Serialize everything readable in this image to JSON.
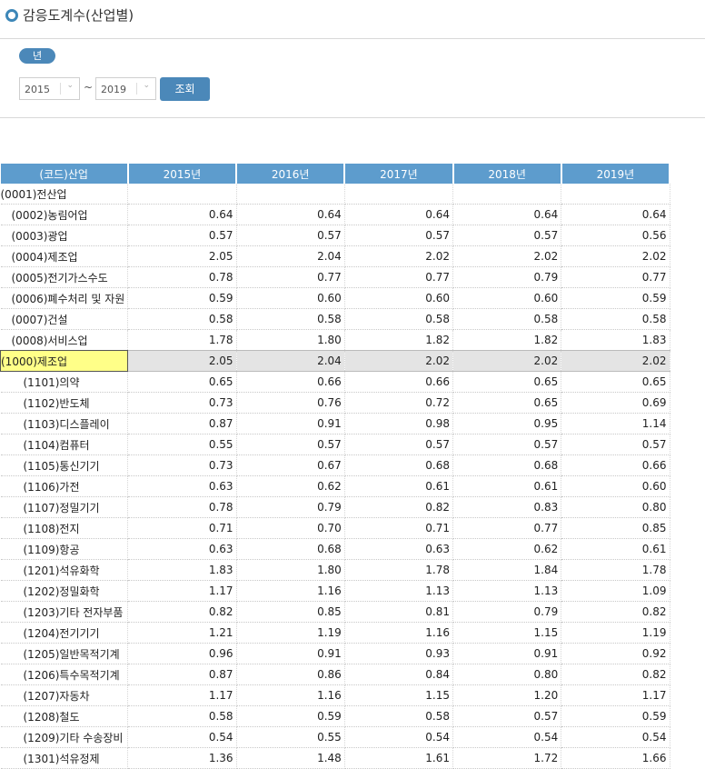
{
  "page": {
    "title": "감응도계수(산업별)"
  },
  "filter": {
    "year_label": "년",
    "from_year": "2015",
    "tilde": "~",
    "to_year": "2019",
    "search_label": "조회"
  },
  "grid": {
    "header_industry": "(코드)산업",
    "years": [
      "2015년",
      "2016년",
      "2017년",
      "2018년",
      "2019년"
    ],
    "rows": [
      {
        "label": "(0001)전산업",
        "level": 0,
        "values": [
          "",
          "",
          "",
          "",
          ""
        ]
      },
      {
        "label": "(0002)농림어업",
        "level": 1,
        "values": [
          "0.64",
          "0.64",
          "0.64",
          "0.64",
          "0.64"
        ]
      },
      {
        "label": "(0003)광업",
        "level": 1,
        "values": [
          "0.57",
          "0.57",
          "0.57",
          "0.57",
          "0.56"
        ]
      },
      {
        "label": "(0004)제조업",
        "level": 1,
        "values": [
          "2.05",
          "2.04",
          "2.02",
          "2.02",
          "2.02"
        ]
      },
      {
        "label": "(0005)전기가스수도",
        "level": 1,
        "values": [
          "0.78",
          "0.77",
          "0.77",
          "0.79",
          "0.77"
        ]
      },
      {
        "label": "(0006)폐수처리 및 자원",
        "level": 1,
        "values": [
          "0.59",
          "0.60",
          "0.60",
          "0.60",
          "0.59"
        ]
      },
      {
        "label": "(0007)건설",
        "level": 1,
        "values": [
          "0.58",
          "0.58",
          "0.58",
          "0.58",
          "0.58"
        ]
      },
      {
        "label": "(0008)서비스업",
        "level": 1,
        "values": [
          "1.78",
          "1.80",
          "1.82",
          "1.82",
          "1.83"
        ]
      },
      {
        "label": "(1000)제조업",
        "level": 0,
        "selected": true,
        "values": [
          "2.05",
          "2.04",
          "2.02",
          "2.02",
          "2.02"
        ]
      },
      {
        "label": "(1101)의약",
        "level": 2,
        "values": [
          "0.65",
          "0.66",
          "0.66",
          "0.65",
          "0.65"
        ]
      },
      {
        "label": "(1102)반도체",
        "level": 2,
        "values": [
          "0.73",
          "0.76",
          "0.72",
          "0.65",
          "0.69"
        ]
      },
      {
        "label": "(1103)디스플레이",
        "level": 2,
        "values": [
          "0.87",
          "0.91",
          "0.98",
          "0.95",
          "1.14"
        ]
      },
      {
        "label": "(1104)컴퓨터",
        "level": 2,
        "values": [
          "0.55",
          "0.57",
          "0.57",
          "0.57",
          "0.57"
        ]
      },
      {
        "label": "(1105)통신기기",
        "level": 2,
        "values": [
          "0.73",
          "0.67",
          "0.68",
          "0.68",
          "0.66"
        ]
      },
      {
        "label": "(1106)가전",
        "level": 2,
        "values": [
          "0.63",
          "0.62",
          "0.61",
          "0.61",
          "0.60"
        ]
      },
      {
        "label": "(1107)정밀기기",
        "level": 2,
        "values": [
          "0.78",
          "0.79",
          "0.82",
          "0.83",
          "0.80"
        ]
      },
      {
        "label": "(1108)전지",
        "level": 2,
        "values": [
          "0.71",
          "0.70",
          "0.71",
          "0.77",
          "0.85"
        ]
      },
      {
        "label": "(1109)항공",
        "level": 2,
        "values": [
          "0.63",
          "0.68",
          "0.63",
          "0.62",
          "0.61"
        ]
      },
      {
        "label": "(1201)석유화학",
        "level": 2,
        "values": [
          "1.83",
          "1.80",
          "1.78",
          "1.84",
          "1.78"
        ]
      },
      {
        "label": "(1202)정밀화학",
        "level": 2,
        "values": [
          "1.17",
          "1.16",
          "1.13",
          "1.13",
          "1.09"
        ]
      },
      {
        "label": "(1203)기타 전자부품",
        "level": 2,
        "values": [
          "0.82",
          "0.85",
          "0.81",
          "0.79",
          "0.82"
        ]
      },
      {
        "label": "(1204)전기기기",
        "level": 2,
        "values": [
          "1.21",
          "1.19",
          "1.16",
          "1.15",
          "1.19"
        ]
      },
      {
        "label": "(1205)일반목적기계",
        "level": 2,
        "values": [
          "0.96",
          "0.91",
          "0.93",
          "0.91",
          "0.92"
        ]
      },
      {
        "label": "(1206)특수목적기계",
        "level": 2,
        "values": [
          "0.87",
          "0.86",
          "0.84",
          "0.80",
          "0.82"
        ]
      },
      {
        "label": "(1207)자동차",
        "level": 2,
        "values": [
          "1.17",
          "1.16",
          "1.15",
          "1.20",
          "1.17"
        ]
      },
      {
        "label": "(1208)철도",
        "level": 2,
        "values": [
          "0.58",
          "0.59",
          "0.58",
          "0.57",
          "0.59"
        ]
      },
      {
        "label": "(1209)기타 수송장비",
        "level": 2,
        "values": [
          "0.54",
          "0.55",
          "0.54",
          "0.54",
          "0.54"
        ]
      },
      {
        "label": "(1301)석유정제",
        "level": 2,
        "values": [
          "1.36",
          "1.48",
          "1.61",
          "1.72",
          "1.66"
        ]
      }
    ]
  },
  "colors": {
    "accent": "#4b88b9",
    "header": "#5d9ccd",
    "selected_cell": "#ffff88",
    "selected_row": "#e4e4e4"
  }
}
